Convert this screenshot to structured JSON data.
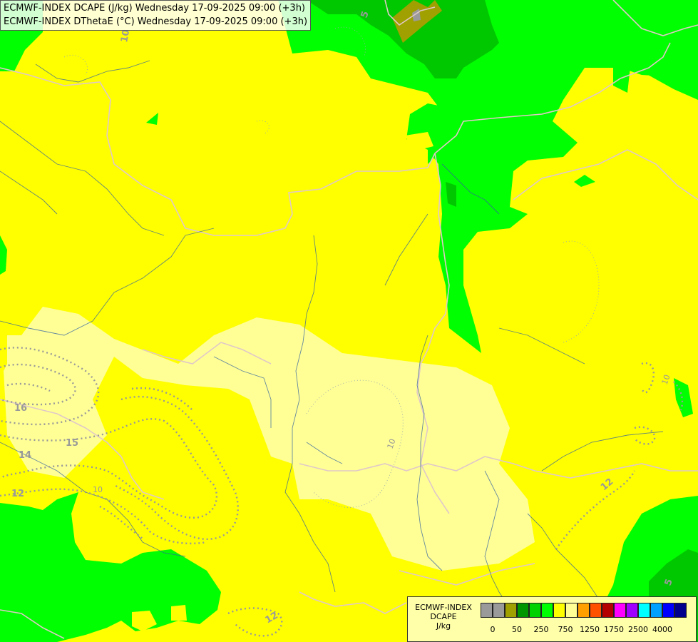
{
  "title_lines": [
    "ECMWF-INDEX DCAPE (J/kg) Wednesday 17-09-2025 09:00 (+3h)",
    "ECMWF-INDEX DThetaE (°C) Wednesday 17-09-2025 09:00 (+3h)"
  ],
  "legend": {
    "title_line1": "ECMWF-INDEX",
    "title_line2": "DCAPE",
    "title_line3": "J/kg",
    "colors": [
      "#9a9a9a",
      "#9a9a9a",
      "#a0a000",
      "#009600",
      "#00d200",
      "#00ff00",
      "#ffff00",
      "#ffff96",
      "#ffa000",
      "#ff5000",
      "#b40000",
      "#ff00ff",
      "#a000ff",
      "#00ffff",
      "#00a0ff",
      "#0000ff",
      "#00008c"
    ],
    "tick_labels": [
      {
        "label": "0",
        "index": 1
      },
      {
        "label": "50",
        "index": 3
      },
      {
        "label": "250",
        "index": 5
      },
      {
        "label": "750",
        "index": 7
      },
      {
        "label": "1250",
        "index": 9
      },
      {
        "label": "1750",
        "index": 11
      },
      {
        "label": "2500",
        "index": 13
      },
      {
        "label": "4000",
        "index": 15
      }
    ]
  },
  "contour_labels": [
    "10",
    "5",
    "16",
    "15",
    "14",
    "12",
    "10",
    "10",
    "10",
    "12",
    "12",
    "5"
  ]
}
